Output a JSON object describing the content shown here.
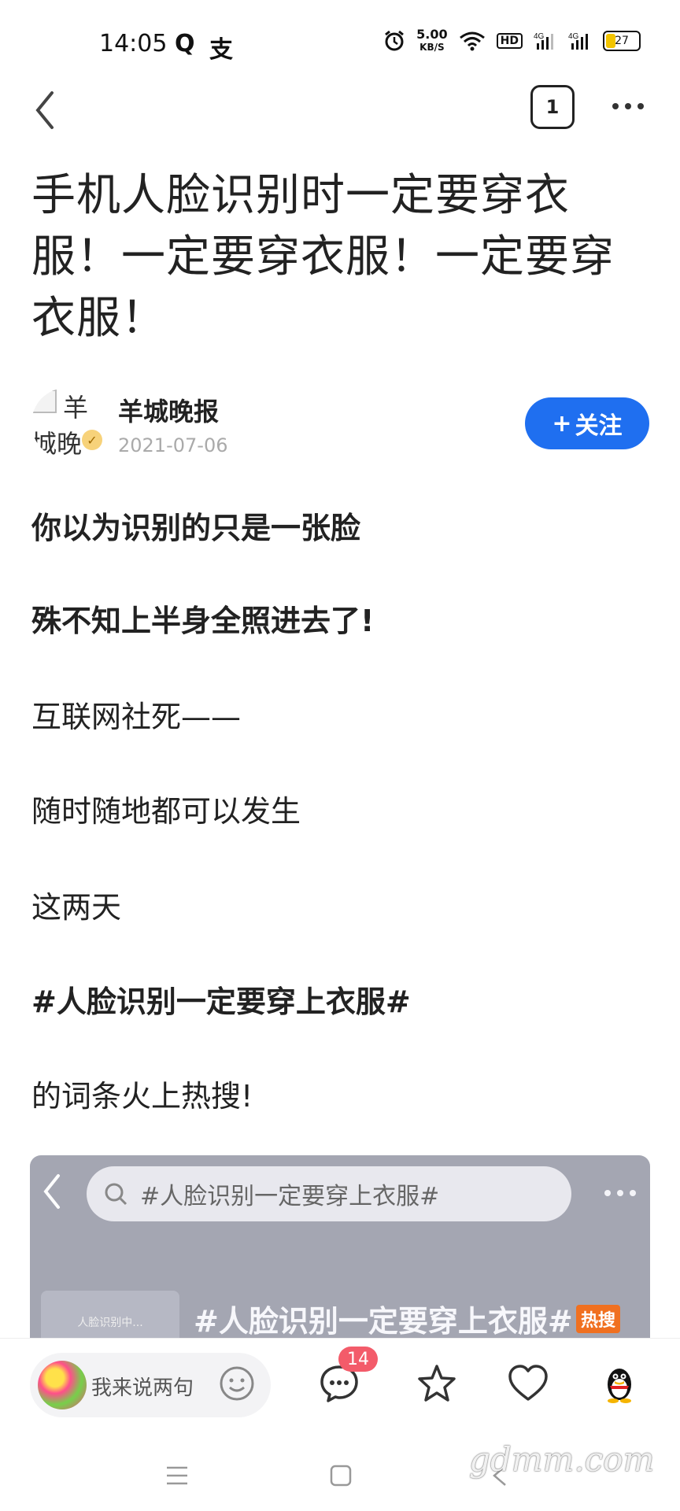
{
  "status_bar": {
    "time": "14:05",
    "network_speed_value": "5.00",
    "network_speed_unit": "KB/S",
    "hd_label": "HD",
    "signal1_label": "4G",
    "signal2_label": "4G",
    "battery_level": "27"
  },
  "nav": {
    "tab_count": "1"
  },
  "article": {
    "title": "手机人脸识别时一定要穿衣服！一定要穿衣服！一定要穿衣服！",
    "author": {
      "avatar_alt_line1": "羊",
      "avatar_alt_line2": "城晚",
      "name": "羊城晚报",
      "date": "2021-07-06"
    },
    "follow_label": "关注",
    "paragraphs": [
      "你以为识别的只是一张脸",
      "殊不知上半身全照进去了!",
      "互联网社死——",
      "随时随地都可以发生",
      "这两天",
      "#人脸识别一定要穿上衣服#",
      "的词条火上热搜!"
    ],
    "embed": {
      "search_text": "#人脸识别一定要穿上衣服#",
      "thumb_text": "人脸识别中...",
      "topic": "#人脸识别一定要穿上衣服#",
      "hot_tag": "热搜"
    }
  },
  "bottom_bar": {
    "comment_placeholder": "我来说两句",
    "comment_count": "14"
  },
  "watermark": "gdmm.com",
  "colors": {
    "accent": "#1f6ff0",
    "badge": "#f35b6a"
  }
}
